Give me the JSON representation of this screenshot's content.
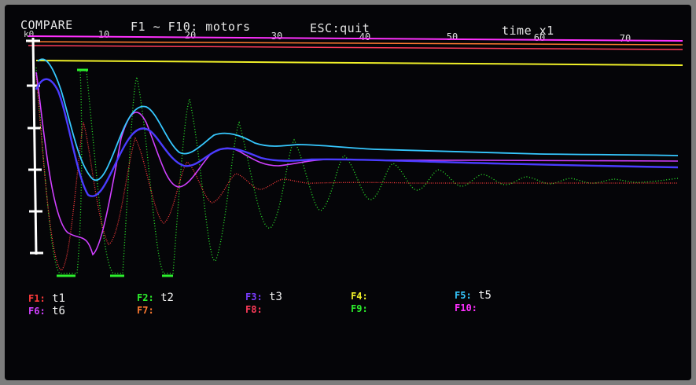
{
  "header": {
    "app_title": "COMPARE",
    "motors_hint": "F1 ~ F10: motors",
    "quit_hint": "ESC:quit",
    "time_scale": "time x1"
  },
  "axis": {
    "y_top_label": "k0",
    "x_ticks": [
      "10",
      "20",
      "30",
      "40",
      "50",
      "60",
      "70"
    ]
  },
  "colors": {
    "F1": "#ff3b3b",
    "F2": "#2cf02c",
    "F3": "#7a3cff",
    "F4": "#f0f028",
    "F5": "#36c8ff",
    "F6": "#d040ff",
    "F7": "#ff7a30",
    "F8": "#ff3b5a",
    "F9": "#2cf02c",
    "F10": "#ff30ff"
  },
  "function_keys": [
    {
      "key": "F1:",
      "trace": "t1",
      "color": "#ff3b3b"
    },
    {
      "key": "F2:",
      "trace": "t2",
      "color": "#2cf02c"
    },
    {
      "key": "F3:",
      "trace": "t3",
      "color": "#7a3cff"
    },
    {
      "key": "F4:",
      "trace": "",
      "color": "#f0f028"
    },
    {
      "key": "F5:",
      "trace": "t5",
      "color": "#36c8ff"
    },
    {
      "key": "F6:",
      "trace": "t6",
      "color": "#d040ff"
    },
    {
      "key": "F7:",
      "trace": "",
      "color": "#ff7a30"
    },
    {
      "key": "F8:",
      "trace": "",
      "color": "#ff3b5a"
    },
    {
      "key": "F9:",
      "trace": "",
      "color": "#2cf02c"
    },
    {
      "key": "F10:",
      "trace": "",
      "color": "#ff30ff"
    }
  ]
}
